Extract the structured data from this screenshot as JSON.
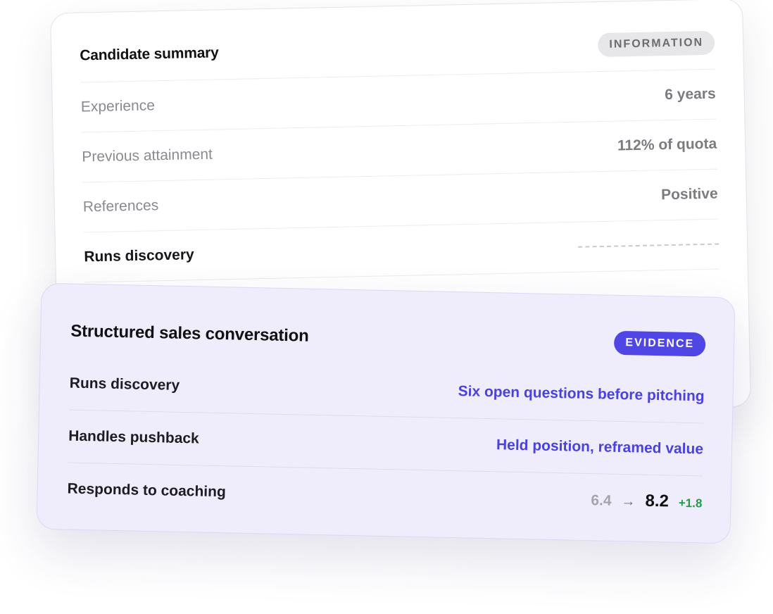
{
  "summary_card": {
    "title": "Candidate summary",
    "badge": "INFORMATION",
    "rows": [
      {
        "label": "Experience",
        "value": "6 years"
      },
      {
        "label": "Previous attainment",
        "value": "112% of quota"
      },
      {
        "label": "References",
        "value": "Positive"
      },
      {
        "label": "Runs discovery",
        "value": ""
      }
    ]
  },
  "evidence_card": {
    "title": "Structured sales conversation",
    "badge": "EVIDENCE",
    "rows": [
      {
        "label": "Runs discovery",
        "value": "Six open questions before pitching"
      },
      {
        "label": "Handles pushback",
        "value": "Held position, reframed value"
      },
      {
        "label": "Responds to coaching",
        "score_before": "6.4",
        "arrow": "→",
        "score_after": "8.2",
        "delta": "+1.8"
      }
    ]
  },
  "colors": {
    "accent": "#4f46e5",
    "evidence_text": "#4a42dd",
    "positive_delta": "#1f9d4a",
    "evidence_card_bg": "#efedfb",
    "info_badge_bg": "#e7e7ea"
  }
}
